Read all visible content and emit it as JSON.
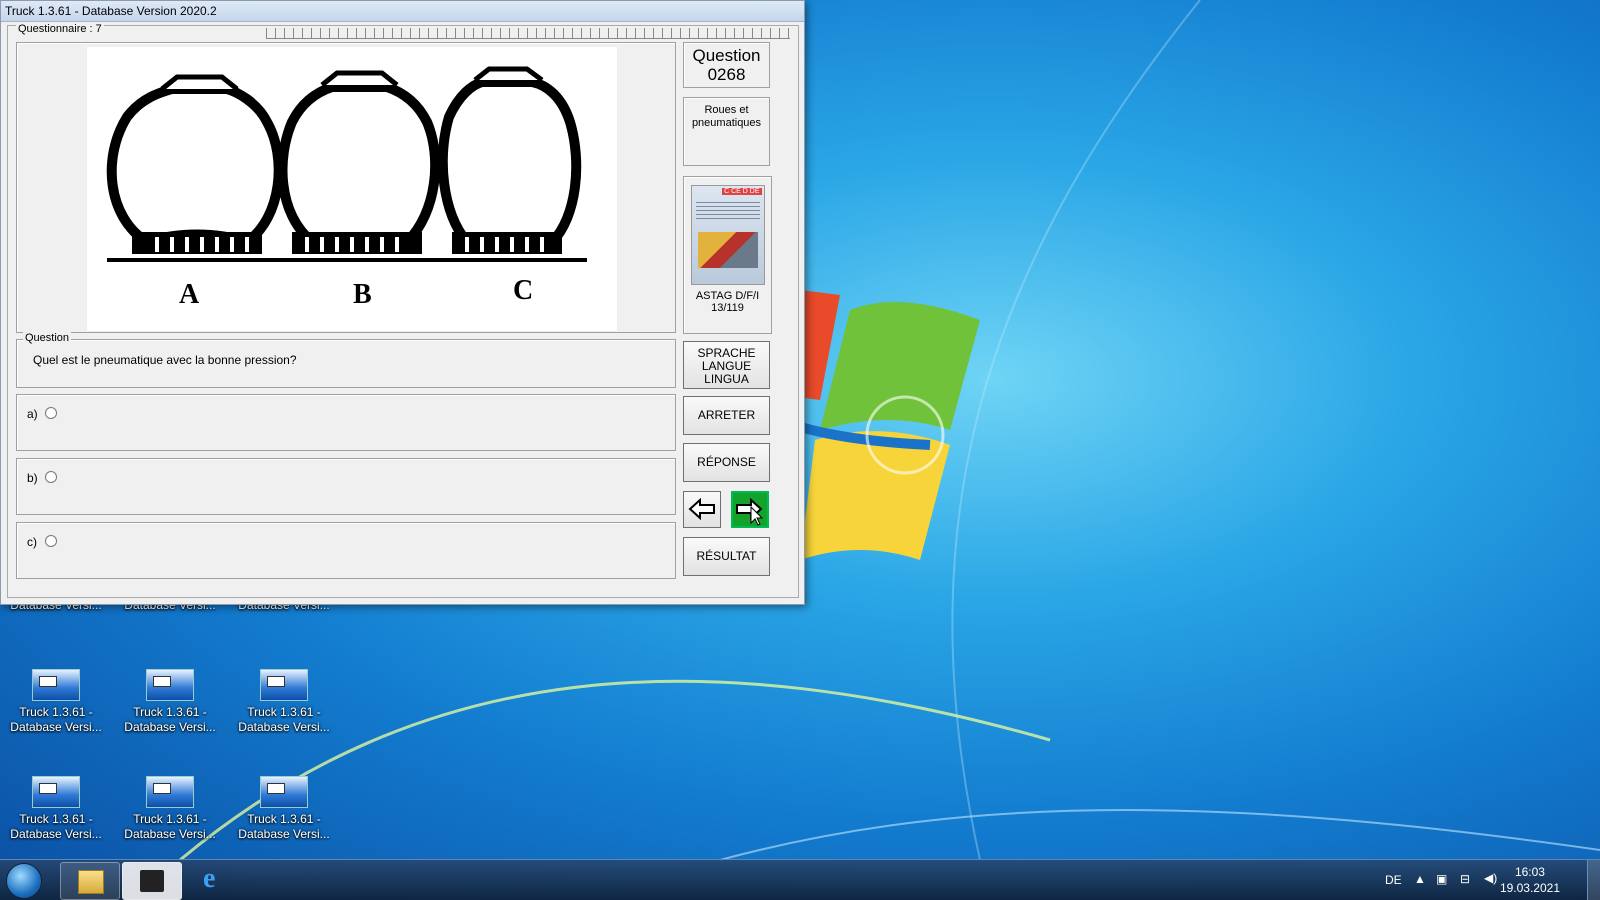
{
  "window": {
    "title": "Truck 1.3.61 - Database Version 2020.2",
    "questionnaire_label": "Questionnaire : 7"
  },
  "image": {
    "labels": [
      "A",
      "B",
      "C"
    ]
  },
  "question": {
    "legend": "Question",
    "text": "Quel est le pneumatique avec la bonne pression?"
  },
  "answers": [
    {
      "label": "a)"
    },
    {
      "label": "b)"
    },
    {
      "label": "c)"
    }
  ],
  "sidebar": {
    "question_title": "Question",
    "question_number": "0268",
    "category_line1": "Roues et",
    "category_line2": "pneumatiques",
    "book_tag": "C CE D DE",
    "book_ref_line1": "ASTAG D/F/I",
    "book_ref_line2": "13/119"
  },
  "buttons": {
    "language_line1": "SPRACHE",
    "language_line2": "LANGUE",
    "language_line3": "LINGUA",
    "stop": "ARRETER",
    "answer": "RÉPONSE",
    "result": "RÉSULTAT"
  },
  "desktop_icons": [
    {
      "line1": "",
      "line2": "Database Versi..."
    },
    {
      "line1": "",
      "line2": "Database Versi..."
    },
    {
      "line1": "",
      "line2": "Database Versi..."
    },
    {
      "line1": "Truck 1.3.61 -",
      "line2": "Database Versi..."
    },
    {
      "line1": "Truck 1.3.61 -",
      "line2": "Database Versi..."
    },
    {
      "line1": "Truck 1.3.61 -",
      "line2": "Database Versi..."
    },
    {
      "line1": "Truck 1.3.61 -",
      "line2": "Database Versi..."
    },
    {
      "line1": "Truck 1.3.61 -",
      "line2": "Database Versi..."
    },
    {
      "line1": "Truck 1.3.61 -",
      "line2": "Database Versi..."
    }
  ],
  "taskbar": {
    "language": "DE",
    "time": "16:03",
    "date": "19.03.2021"
  }
}
